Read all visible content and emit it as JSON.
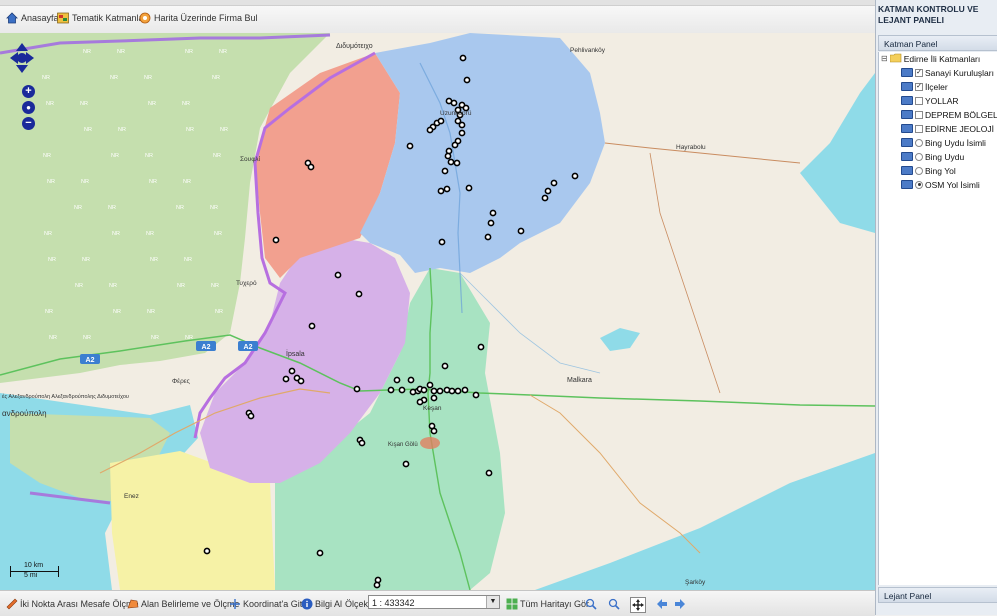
{
  "toolbar": {
    "home_label": "Anasayfa",
    "thematic_label": "Tematik Katmanlar",
    "find_company_label": "Harita Üzerinde Firma Bul"
  },
  "map": {
    "place_labels": [
      {
        "text": "Διδυμότειχο",
        "key": "didymoteicho"
      },
      {
        "text": "Pehlivanköy",
        "key": "pehlivankoy"
      },
      {
        "text": "Uzunköprü",
        "key": "uzunkopru"
      },
      {
        "text": "Hayrabolu",
        "key": "hayrabolu"
      },
      {
        "text": "Σουφλί",
        "key": "soufli"
      },
      {
        "text": "Τυχερό",
        "key": "tychero"
      },
      {
        "text": "İpsala",
        "key": "ipsala"
      },
      {
        "text": "Φέρες",
        "key": "feres"
      },
      {
        "text": "Malkara",
        "key": "malkara"
      },
      {
        "text": "Keşan",
        "key": "kesan"
      },
      {
        "text": "Kışan Gölü",
        "key": "kisan"
      },
      {
        "text": "Enez",
        "key": "enez"
      },
      {
        "text": "Şarköy",
        "key": "sarkoy"
      },
      {
        "text": "ανδρούπολη",
        "key": "alexandroupoli"
      },
      {
        "text": "ές Αλεξανδρούπολη Αλεξανδρούπολης Διδυμοτείχου",
        "key": "greek_road"
      }
    ],
    "road_shields": [
      "A2",
      "A2",
      "A2"
    ],
    "nr_text": "NR",
    "scale_km": "10 km",
    "scale_mi": "5 mi",
    "zoom_in": "+",
    "zoom_out": "−",
    "colors": {
      "uzunkopru": "#a9c8ee",
      "meric": "#f2a08f",
      "ipsala": "#d6b1e8",
      "kesan": "#a8e3c2",
      "enez": "#f6f2a6",
      "sea": "#8fdbe8",
      "land": "#f2ede3",
      "greece_green": "#c5dfae",
      "points": "#000000"
    }
  },
  "bottombar": {
    "measure_label": "İki Nokta Arası Mesafe Ölçme",
    "area_label": "Alan Belirleme ve Ölçme",
    "goto_label": "Koordinat'a Git",
    "info_label": "Bilgi Al",
    "scale_label": "Ölçek",
    "scale_value": "1 : 433342",
    "fullmap_label": "Tüm Haritayı Gör"
  },
  "right_panel": {
    "title": "KATMAN KONTROLU VE LEJANT PANELI",
    "layer_panel_label": "Katman Panel",
    "legend_panel_label": "Lejant Panel",
    "root_label": "Edirne İli Katmanları",
    "layers": [
      {
        "label": "Sanayi Kuruluşları",
        "kind": "checkbox",
        "checked": true
      },
      {
        "label": "İlçeler",
        "kind": "checkbox",
        "checked": true
      },
      {
        "label": "YOLLAR",
        "kind": "checkbox",
        "checked": false
      },
      {
        "label": "DEPREM BÖLGELERİ",
        "kind": "checkbox",
        "checked": false
      },
      {
        "label": "EDİRNE JEOLOJİ",
        "kind": "checkbox",
        "checked": false
      },
      {
        "label": "Bing Uydu İsimli",
        "kind": "radio",
        "checked": false
      },
      {
        "label": "Bing Uydu",
        "kind": "radio",
        "checked": false
      },
      {
        "label": "Bing Yol",
        "kind": "radio",
        "checked": false
      },
      {
        "label": "OSM Yol İsimli",
        "kind": "radio",
        "checked": true
      }
    ]
  }
}
